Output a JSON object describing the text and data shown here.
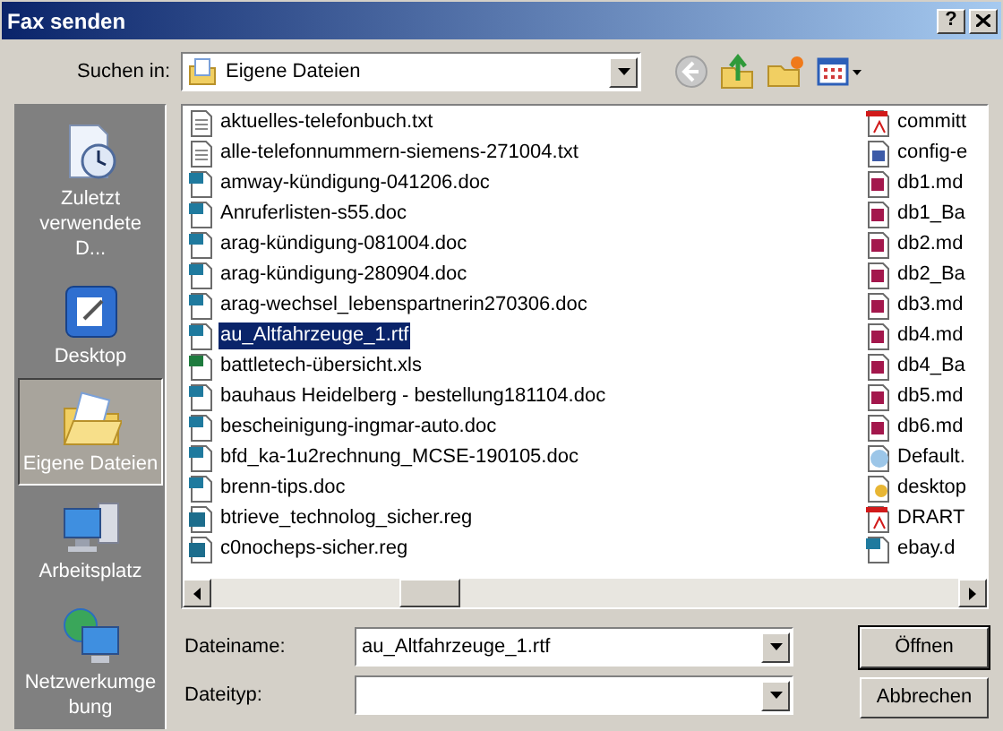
{
  "window": {
    "title": "Fax senden"
  },
  "title_buttons": [
    {
      "kind": "help",
      "label": "?"
    },
    {
      "kind": "close"
    }
  ],
  "look_in": {
    "label": "Suchen in:",
    "value": "Eigene Dateien"
  },
  "toolbar": [
    {
      "kind": "back",
      "disabled": true
    },
    {
      "kind": "up",
      "disabled": false
    },
    {
      "kind": "new_folder",
      "disabled": false
    },
    {
      "kind": "view",
      "disabled": false
    }
  ],
  "places": [
    {
      "label": "Zuletzt verwendete D...",
      "kind": "recent",
      "selected": false
    },
    {
      "label": "Desktop",
      "kind": "desktop",
      "selected": false
    },
    {
      "label": "Eigene Dateien",
      "kind": "documents",
      "selected": true
    },
    {
      "label": "Arbeitsplatz",
      "kind": "computer",
      "selected": false
    },
    {
      "label": "Netzwerkumgebung",
      "kind": "network",
      "selected": false
    }
  ],
  "file_columns": [
    {
      "items": [
        {
          "name": "aktuelles-telefonbuch.txt",
          "kind": "txt",
          "selected": false
        },
        {
          "name": "alle-telefonnummern-siemens-271004.txt",
          "kind": "txt",
          "selected": false
        },
        {
          "name": "amway-kündigung-041206.doc",
          "kind": "doc",
          "selected": false
        },
        {
          "name": "Anruferlisten-s55.doc",
          "kind": "doc",
          "selected": false
        },
        {
          "name": "arag-kündigung-081004.doc",
          "kind": "doc",
          "selected": false
        },
        {
          "name": "arag-kündigung-280904.doc",
          "kind": "doc",
          "selected": false
        },
        {
          "name": "arag-wechsel_lebenspartnerin270306.doc",
          "kind": "doc",
          "selected": false
        },
        {
          "name": "au_Altfahrzeuge_1.rtf",
          "kind": "doc",
          "selected": true
        },
        {
          "name": "battletech-übersicht.xls",
          "kind": "xls",
          "selected": false
        },
        {
          "name": "bauhaus Heidelberg - bestellung181104.doc",
          "kind": "doc",
          "selected": false
        },
        {
          "name": "bescheinigung-ingmar-auto.doc",
          "kind": "doc",
          "selected": false
        },
        {
          "name": "bfd_ka-1u2rechnung_MCSE-190105.doc",
          "kind": "doc",
          "selected": false
        },
        {
          "name": "brenn-tips.doc",
          "kind": "doc",
          "selected": false
        },
        {
          "name": "btrieve_technolog_sicher.reg",
          "kind": "reg",
          "selected": false
        },
        {
          "name": "c0nocheps-sicher.reg",
          "kind": "reg",
          "selected": false
        }
      ]
    },
    {
      "items": [
        {
          "name": "committ",
          "kind": "pdf",
          "selected": false
        },
        {
          "name": "config-e",
          "kind": "config",
          "selected": false
        },
        {
          "name": "db1.md",
          "kind": "mdb",
          "selected": false
        },
        {
          "name": "db1_Ba",
          "kind": "mdb",
          "selected": false
        },
        {
          "name": "db2.md",
          "kind": "mdb",
          "selected": false
        },
        {
          "name": "db2_Ba",
          "kind": "mdb",
          "selected": false
        },
        {
          "name": "db3.md",
          "kind": "mdb",
          "selected": false
        },
        {
          "name": "db4.md",
          "kind": "mdb",
          "selected": false
        },
        {
          "name": "db4_Ba",
          "kind": "mdb",
          "selected": false
        },
        {
          "name": "db5.md",
          "kind": "mdb",
          "selected": false
        },
        {
          "name": "db6.md",
          "kind": "mdb",
          "selected": false
        },
        {
          "name": "Default.",
          "kind": "web",
          "selected": false
        },
        {
          "name": "desktop",
          "kind": "ini",
          "selected": false
        },
        {
          "name": "DRART",
          "kind": "pdf",
          "selected": false
        },
        {
          "name": "ebay.d",
          "kind": "doc",
          "selected": false
        }
      ]
    }
  ],
  "file_name": {
    "label": "Dateiname:",
    "value": "au_Altfahrzeuge_1.rtf"
  },
  "file_type": {
    "label": "Dateityp:"
  },
  "buttons": [
    {
      "label": "Öffnen",
      "default": true
    },
    {
      "label": "Abbrechen",
      "default": false
    }
  ]
}
